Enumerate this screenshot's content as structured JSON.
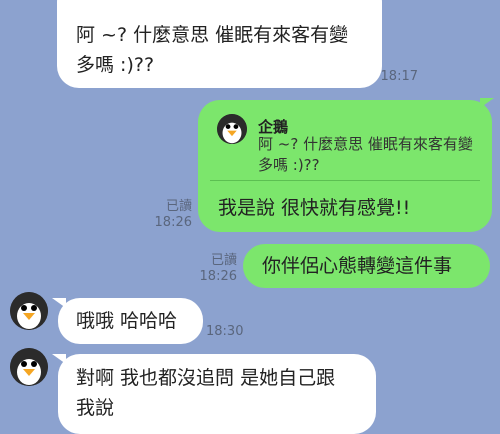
{
  "chat": {
    "messages": [
      {
        "id": "m1",
        "side": "incoming",
        "text": "阿 ~? 什麼意思 催眠有來客有變\n多嗎 :)??",
        "time": "18:17"
      },
      {
        "id": "m2",
        "side": "outgoing",
        "reply_to": {
          "name": "企鵝",
          "text": "阿 ~? 什麼意思 催眠有來客有變\n多嗎 :)??"
        },
        "text": "我是說 很快就有感覺!!",
        "read": "已讀",
        "time": "18:26"
      },
      {
        "id": "m3",
        "side": "outgoing",
        "text": "你伴侶心態轉變這件事",
        "read": "已讀",
        "time": "18:26"
      },
      {
        "id": "m4",
        "side": "incoming",
        "text": "哦哦 哈哈哈",
        "time": "18:30"
      },
      {
        "id": "m5",
        "side": "incoming",
        "text": "對啊 我也都沒追問 是她自己跟\n我說"
      }
    ]
  },
  "colors": {
    "background": "#8ca2cf",
    "incoming_bubble": "#ffffff",
    "outgoing_bubble": "#7ce66c"
  },
  "icons": {
    "avatar": "penguin-avatar-icon"
  }
}
